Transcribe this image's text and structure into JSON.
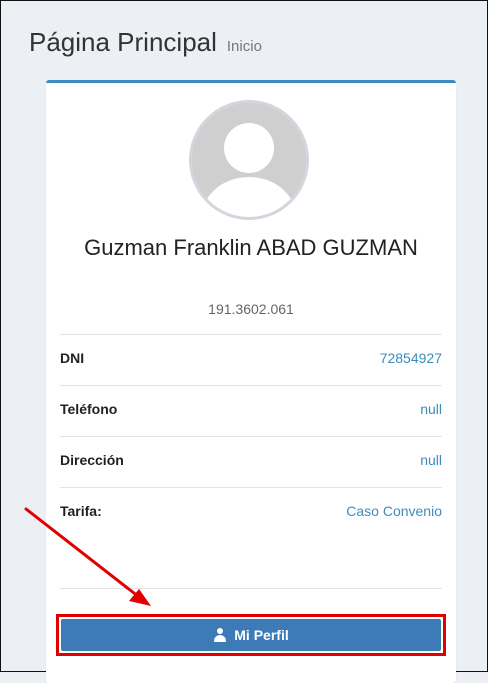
{
  "header": {
    "title": "Página Principal",
    "subtitle": "Inicio"
  },
  "profile": {
    "name": "Guzman Franklin ABAD GUZMAN",
    "code": "191.3602.061",
    "avatar_icon": "default-user-avatar"
  },
  "details": [
    {
      "label": "DNI",
      "value": "72854927"
    },
    {
      "label": "Teléfono",
      "value": "null"
    },
    {
      "label": "Dirección",
      "value": "null"
    },
    {
      "label": "Tarifa:",
      "value": "Caso Convenio"
    }
  ],
  "action": {
    "label": "Mi Perfil",
    "icon": "user-icon"
  },
  "colors": {
    "accent": "#3c8dbc",
    "button": "#3c7ab8",
    "highlight": "#e00000"
  }
}
